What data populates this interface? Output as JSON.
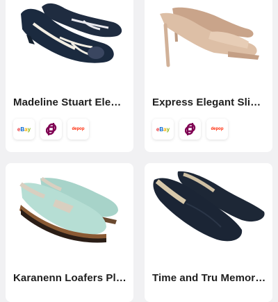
{
  "products": [
    {
      "title": "Madeline Stuart Elegan...",
      "image_icon": "navy-peep-toe-flat-image",
      "marketplaces": [
        "eBay",
        "poshmark",
        "depop"
      ]
    },
    {
      "title": "Express Elegant Slip O...",
      "image_icon": "beige-heel-mule-image",
      "marketplaces": [
        "eBay",
        "poshmark",
        "depop"
      ]
    },
    {
      "title": "Karanenn Loafers Platf...",
      "image_icon": "mint-loafer-image",
      "marketplaces": []
    },
    {
      "title": "Time and Tru Memory...",
      "image_icon": "black-loafer-image",
      "marketplaces": []
    }
  ],
  "marketplace_labels": {
    "ebay": "eBay",
    "depop": "depop"
  },
  "colors": {
    "background": "#f1f1f3",
    "card": "#ffffff",
    "poshmark": "#7f0353",
    "depop": "#ff2300",
    "ebay_letters": [
      "#e53238",
      "#0064d2",
      "#f5af02",
      "#86b817"
    ]
  }
}
